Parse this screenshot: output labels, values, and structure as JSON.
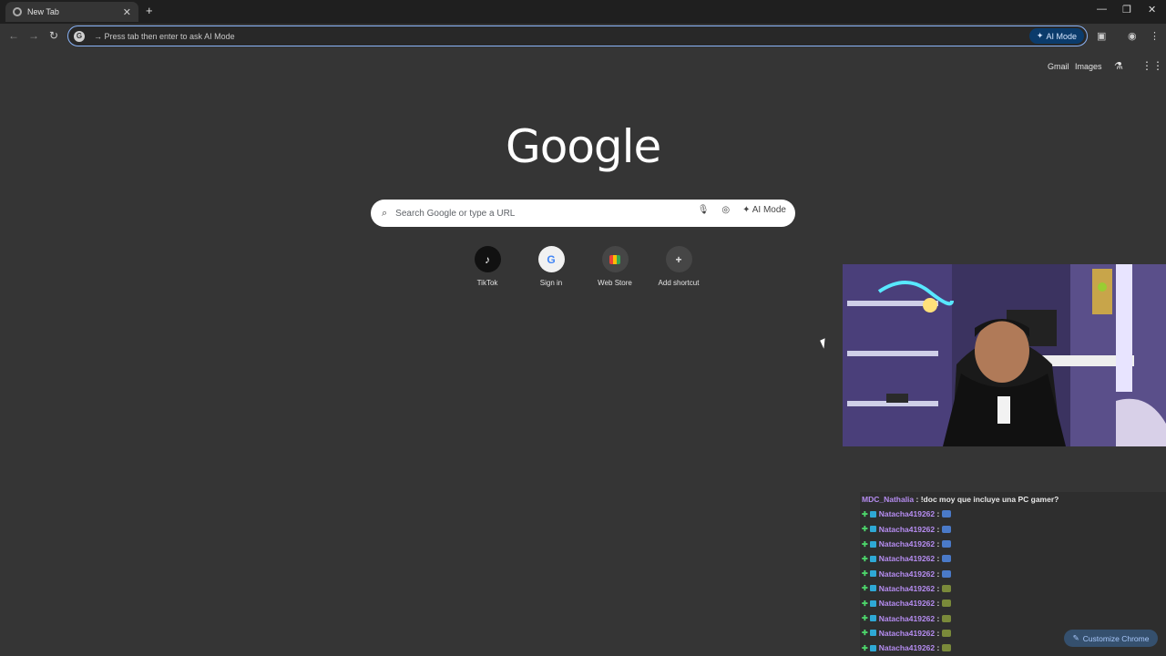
{
  "tab": {
    "title": "New Tab"
  },
  "omnibox": {
    "placeholder": "→ Press tab then enter to ask AI Mode",
    "ai_mode_label": "AI Mode"
  },
  "top_links": {
    "gmail": "Gmail",
    "images": "Images"
  },
  "logo": "Google",
  "search": {
    "placeholder": "Search Google or type a URL",
    "ai_mode_label": "AI Mode"
  },
  "shortcuts": [
    {
      "label": "TikTok",
      "icon": "tiktok-icon"
    },
    {
      "label": "Sign in",
      "icon": "google-icon"
    },
    {
      "label": "Web Store",
      "icon": "webstore-icon"
    },
    {
      "label": "Add shortcut",
      "icon": "plus-icon"
    }
  ],
  "chat": {
    "messages": [
      {
        "user": "MDC_Nathalia",
        "text": ": !doc moy que incluye una PC gamer?"
      },
      {
        "user": "Natacha419262",
        "text": ":"
      },
      {
        "user": "Natacha419262",
        "text": ":"
      },
      {
        "user": "Natacha419262",
        "text": ":"
      },
      {
        "user": "Natacha419262",
        "text": ":"
      },
      {
        "user": "Natacha419262",
        "text": ":"
      },
      {
        "user": "Natacha419262",
        "text": ":"
      },
      {
        "user": "Natacha419262",
        "text": ":"
      },
      {
        "user": "Natacha419262",
        "text": ":"
      },
      {
        "user": "Natacha419262",
        "text": ":"
      },
      {
        "user": "Natacha419262",
        "text": ":"
      }
    ]
  },
  "customize_label": "Customize Chrome",
  "colors": {
    "background": "#353535",
    "accent": "#8ab4f8",
    "chat_user": "#b58cf0"
  }
}
